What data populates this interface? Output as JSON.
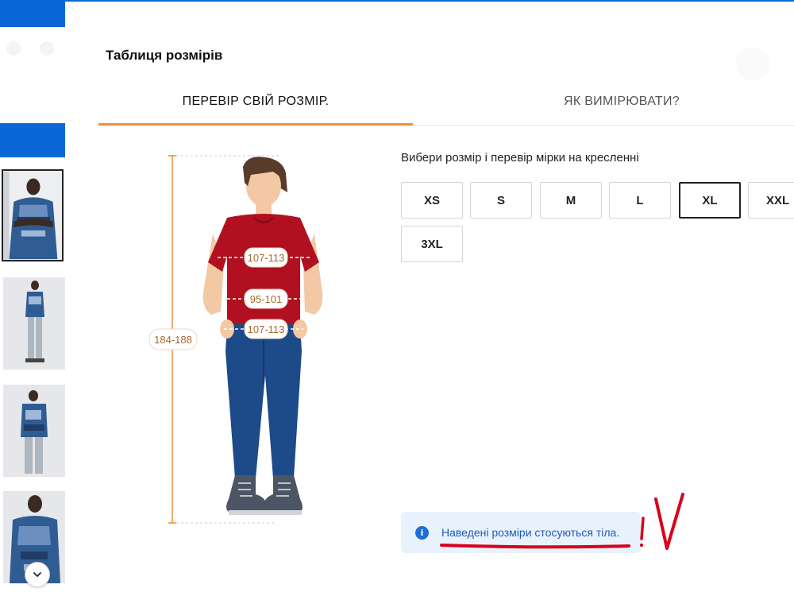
{
  "modal": {
    "title": "Таблиця розмірів",
    "tabs": [
      {
        "label": "ПЕРЕВІР СВІЙ РОЗМІР.",
        "active": true
      },
      {
        "label": "ЯК ВИМІРЮВАТИ?",
        "active": false
      }
    ]
  },
  "size_picker": {
    "prompt": "Вибери розмір і перевір мірки на кресленні",
    "sizes": [
      "XS",
      "S",
      "M",
      "L",
      "XL",
      "XXL",
      "3XL"
    ],
    "selected": "XL"
  },
  "measurements": {
    "height": "184-188",
    "chest": "107-113",
    "waist": "95-101",
    "hips": "107-113"
  },
  "info": {
    "icon": "info-icon",
    "text": "Наведені розміри стосуються тіла."
  },
  "gallery": {
    "thumbnails": 4,
    "scroll_icon": "chevron-down-icon"
  },
  "colors": {
    "brand_blue": "#0a67d6",
    "tab_accent": "#e8913a",
    "annotation_red": "#d9001b",
    "info_bg": "#e8f2fd"
  }
}
